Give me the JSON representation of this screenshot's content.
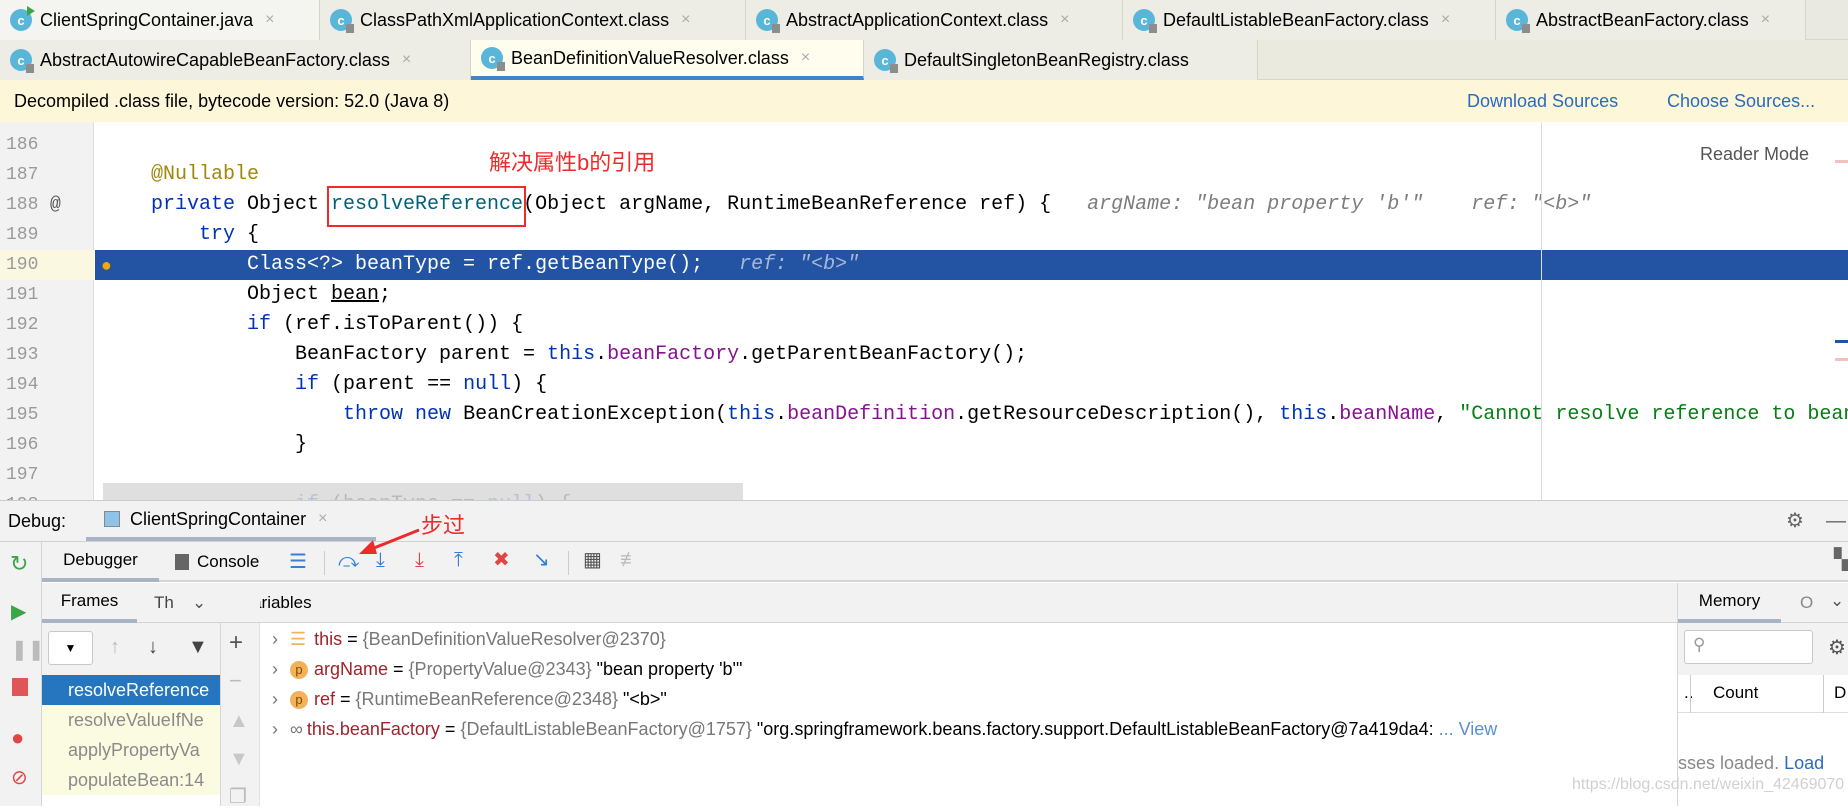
{
  "tabs_row1": [
    {
      "label": "ClientSpringContainer.java",
      "icon": "java-class-run-icon"
    },
    {
      "label": "ClassPathXmlApplicationContext.class",
      "icon": "class-file-icon"
    },
    {
      "label": "AbstractApplicationContext.class",
      "icon": "class-file-icon"
    },
    {
      "label": "DefaultListableBeanFactory.class",
      "icon": "class-file-icon"
    },
    {
      "label": "AbstractBeanFactory.class",
      "icon": "class-file-icon"
    }
  ],
  "tabs_row2": [
    {
      "label": "AbstractAutowireCapableBeanFactory.class",
      "active": false
    },
    {
      "label": "BeanDefinitionValueResolver.class",
      "active": true
    },
    {
      "label": "DefaultSingletonBeanRegistry.class",
      "active": false
    }
  ],
  "tab_icon_letter": "c",
  "close_glyph": "×",
  "banner": {
    "text": "Decompiled .class file, bytecode version: 52.0 (Java 8)",
    "download": "Download Sources",
    "choose": "Choose Sources..."
  },
  "editor": {
    "reader_mode": "Reader Mode",
    "current_line": 190,
    "lines": [
      {
        "n": "186",
        "tokens": []
      },
      {
        "n": "187",
        "tokens": [
          [
            "@Nullable",
            "an"
          ]
        ]
      },
      {
        "n": "188",
        "marker": "@",
        "tokens": [
          [
            "private ",
            "kw"
          ],
          [
            "Object ",
            ""
          ],
          [
            "resolveReference",
            "fn"
          ],
          [
            "(Object argName, RuntimeBeanReference ref) {",
            ""
          ],
          [
            "   argName: \"bean property 'b'\"    ref: \"<b>\"",
            "hint"
          ]
        ]
      },
      {
        "n": "189",
        "tokens": [
          [
            "    ",
            ""
          ],
          [
            "try",
            "kw"
          ],
          [
            " {",
            ""
          ]
        ]
      },
      {
        "n": "190",
        "tokens": [
          [
            "        Class<?> beanType = ref.getBeanType();",
            ""
          ],
          [
            "   ref: \"<b>\"",
            "hint"
          ]
        ]
      },
      {
        "n": "191",
        "tokens": [
          [
            "        Object ",
            ""
          ],
          [
            "bean",
            "ul"
          ],
          [
            ";",
            ""
          ]
        ]
      },
      {
        "n": "192",
        "tokens": [
          [
            "        ",
            ""
          ],
          [
            "if",
            "kw"
          ],
          [
            " (ref.isToParent()) {",
            ""
          ]
        ]
      },
      {
        "n": "193",
        "tokens": [
          [
            "            BeanFactory parent = ",
            ""
          ],
          [
            "this",
            "kw"
          ],
          [
            ".",
            ""
          ],
          [
            "beanFactory",
            "fd"
          ],
          [
            ".getParentBeanFactory();",
            ""
          ]
        ]
      },
      {
        "n": "194",
        "tokens": [
          [
            "            ",
            ""
          ],
          [
            "if",
            "kw"
          ],
          [
            " (parent == ",
            ""
          ],
          [
            "null",
            "kw"
          ],
          [
            ") {",
            ""
          ]
        ]
      },
      {
        "n": "195",
        "tokens": [
          [
            "                ",
            ""
          ],
          [
            "throw new ",
            "kw"
          ],
          [
            "BeanCreationException(",
            ""
          ],
          [
            "this",
            "kw"
          ],
          [
            ".",
            ""
          ],
          [
            "beanDefinition",
            "fd"
          ],
          [
            ".getResourceDescription(), ",
            ""
          ],
          [
            "this",
            "kw"
          ],
          [
            ".",
            ""
          ],
          [
            "beanName",
            "fd"
          ],
          [
            ", ",
            ""
          ],
          [
            "\"Cannot resolve reference to bean",
            "st"
          ]
        ]
      },
      {
        "n": "196",
        "tokens": [
          [
            "            }",
            ""
          ]
        ]
      },
      {
        "n": "197",
        "tokens": []
      },
      {
        "n": "198",
        "tokens": [
          [
            "            ",
            ""
          ],
          [
            "if",
            "kw"
          ],
          [
            " (beanType == ",
            ""
          ],
          [
            "null",
            "kw"
          ],
          [
            ") {",
            ""
          ]
        ]
      }
    ]
  },
  "annotations": {
    "box_note": "解决属性b的引用",
    "step_note": "步过",
    "color": "#ee2b2b"
  },
  "debug": {
    "label": "Debug:",
    "session": "ClientSpringContainer",
    "tabs": {
      "debugger": "Debugger",
      "console": "Console"
    },
    "toolbar_icons": [
      "show-execution-point-icon",
      "step-over-icon",
      "step-into-icon",
      "force-step-into-icon",
      "step-out-icon",
      "drop-frame-icon",
      "run-to-cursor-icon",
      "evaluate-expression-icon",
      "trace-icon"
    ],
    "frames_tab": "Frames",
    "threads_tab": "Th",
    "variables_tab": "Variables",
    "frames": [
      {
        "label": "resolveReference",
        "selected": true
      },
      {
        "label": "resolveValueIfNe",
        "selected": false
      },
      {
        "label": "applyPropertyVa",
        "selected": false
      },
      {
        "label": "populateBean:14",
        "selected": false
      }
    ],
    "variables": [
      {
        "icon": "field-stack-icon",
        "name": "this",
        "type": "{BeanDefinitionValueResolver@2370}",
        "value": ""
      },
      {
        "icon": "p",
        "name": "argName",
        "type": "{PropertyValue@2343}",
        "value": " \"bean property 'b'\""
      },
      {
        "icon": "p",
        "name": "ref",
        "type": "{RuntimeBeanReference@2348}",
        "value": " \"<b>\""
      },
      {
        "icon": "watch-glasses-icon",
        "name": "this.beanFactory",
        "type": "{DefaultListableBeanFactory@1757}",
        "value": " \"org.springframework.beans.factory.support.DefaultListableBeanFactory@7a419da4:",
        "more": " ... View"
      }
    ],
    "eq": " = ",
    "memory": {
      "tab": "Memory",
      "other_tab": "O",
      "col_dots": "..",
      "col_count": "Count",
      "col_d": "D",
      "status": "sses loaded. ",
      "load": "Load"
    }
  },
  "watermark": "https://blog.csdn.net/weixin_42469070"
}
